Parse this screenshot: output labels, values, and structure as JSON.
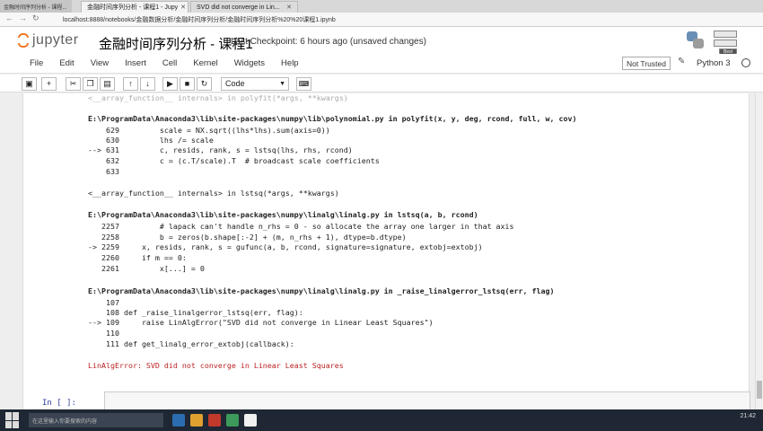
{
  "top_strip": {
    "app_tab": "金融时间序列分析 - 课程..."
  },
  "browser": {
    "tabs": [
      {
        "label": "金融时间序列分析 - 课程1 - Jupy",
        "active": true
      },
      {
        "label": "SVD did not converge in Lin...",
        "active": false
      }
    ],
    "url": "localhost:8888/notebooks/金融数据分析/金融时间序列分析/金融时间序列分析%20%20课程1.ipynb"
  },
  "header": {
    "logo_text": "jupyter",
    "notebook_title": "金融时间序列分析 - 课程1",
    "checkpoint": "Last Checkpoint: 6 hours ago (unsaved changes)",
    "mini_btns": [
      "",
      "",
      "Best"
    ]
  },
  "menubar": {
    "items": [
      "File",
      "Edit",
      "View",
      "Insert",
      "Cell",
      "Kernel",
      "Widgets",
      "Help"
    ],
    "trusted": "Not Trusted",
    "kernel": "Python 3"
  },
  "toolbar": {
    "buttons": [
      "save-icon",
      "plus-icon",
      "scissors-icon",
      "copy-icon",
      "paste-icon",
      "arrow-up-icon",
      "arrow-down-icon"
    ],
    "cell_type": "Code"
  },
  "traceback": {
    "l0": "<__array_function__ internals> in polyfit(*args, **kwargs)",
    "file1": "E:\\ProgramData\\Anaconda3\\lib\\site-packages\\numpy\\lib\\polynomial.py in polyfit(x, y, deg, rcond, full, w, cov)",
    "f1_629": "    629         scale = NX.sqrt((lhs*lhs).sum(axis=0))",
    "f1_630": "    630         lhs /= scale",
    "f1_631": "--> 631         c, resids, rank, s = lstsq(lhs, rhs, rcond)",
    "f1_632": "    632         c = (c.T/scale).T  # broadcast scale coefficients",
    "f1_633": "    633 ",
    "l_lstsq": "<__array_function__ internals> in lstsq(*args, **kwargs)",
    "file2": "E:\\ProgramData\\Anaconda3\\lib\\site-packages\\numpy\\linalg\\linalg.py in lstsq(a, b, rcond)",
    "f2_2257": "   2257         # lapack can't handle n_rhs = 0 - so allocate the array one larger in that axis",
    "f2_2258": "   2258         b = zeros(b.shape[:-2] + (m, n_rhs + 1), dtype=b.dtype)",
    "f2_2259": "-> 2259     x, resids, rank, s = gufunc(a, b, rcond, signature=signature, extobj=extobj)",
    "f2_2260": "   2260     if m == 0:",
    "f2_2261": "   2261         x[...] = 0",
    "file3": "E:\\ProgramData\\Anaconda3\\lib\\site-packages\\numpy\\linalg\\linalg.py in _raise_linalgerror_lstsq(err, flag)",
    "f3_107": "    107 ",
    "f3_108": "    108 def _raise_linalgerror_lstsq(err, flag):",
    "f3_109": "--> 109     raise LinAlgError(\"SVD did not converge in Linear Least Squares\")",
    "f3_110": "    110 ",
    "f3_111": "    111 def get_linalg_error_extobj(callback):",
    "error": "LinAlgError: SVD did not converge in Linear Least Squares"
  },
  "next_cell": {
    "prompt": "In  [  ]:"
  },
  "taskbar": {
    "search_placeholder": "在这里输入你要搜索的内容",
    "time": "21:42"
  }
}
